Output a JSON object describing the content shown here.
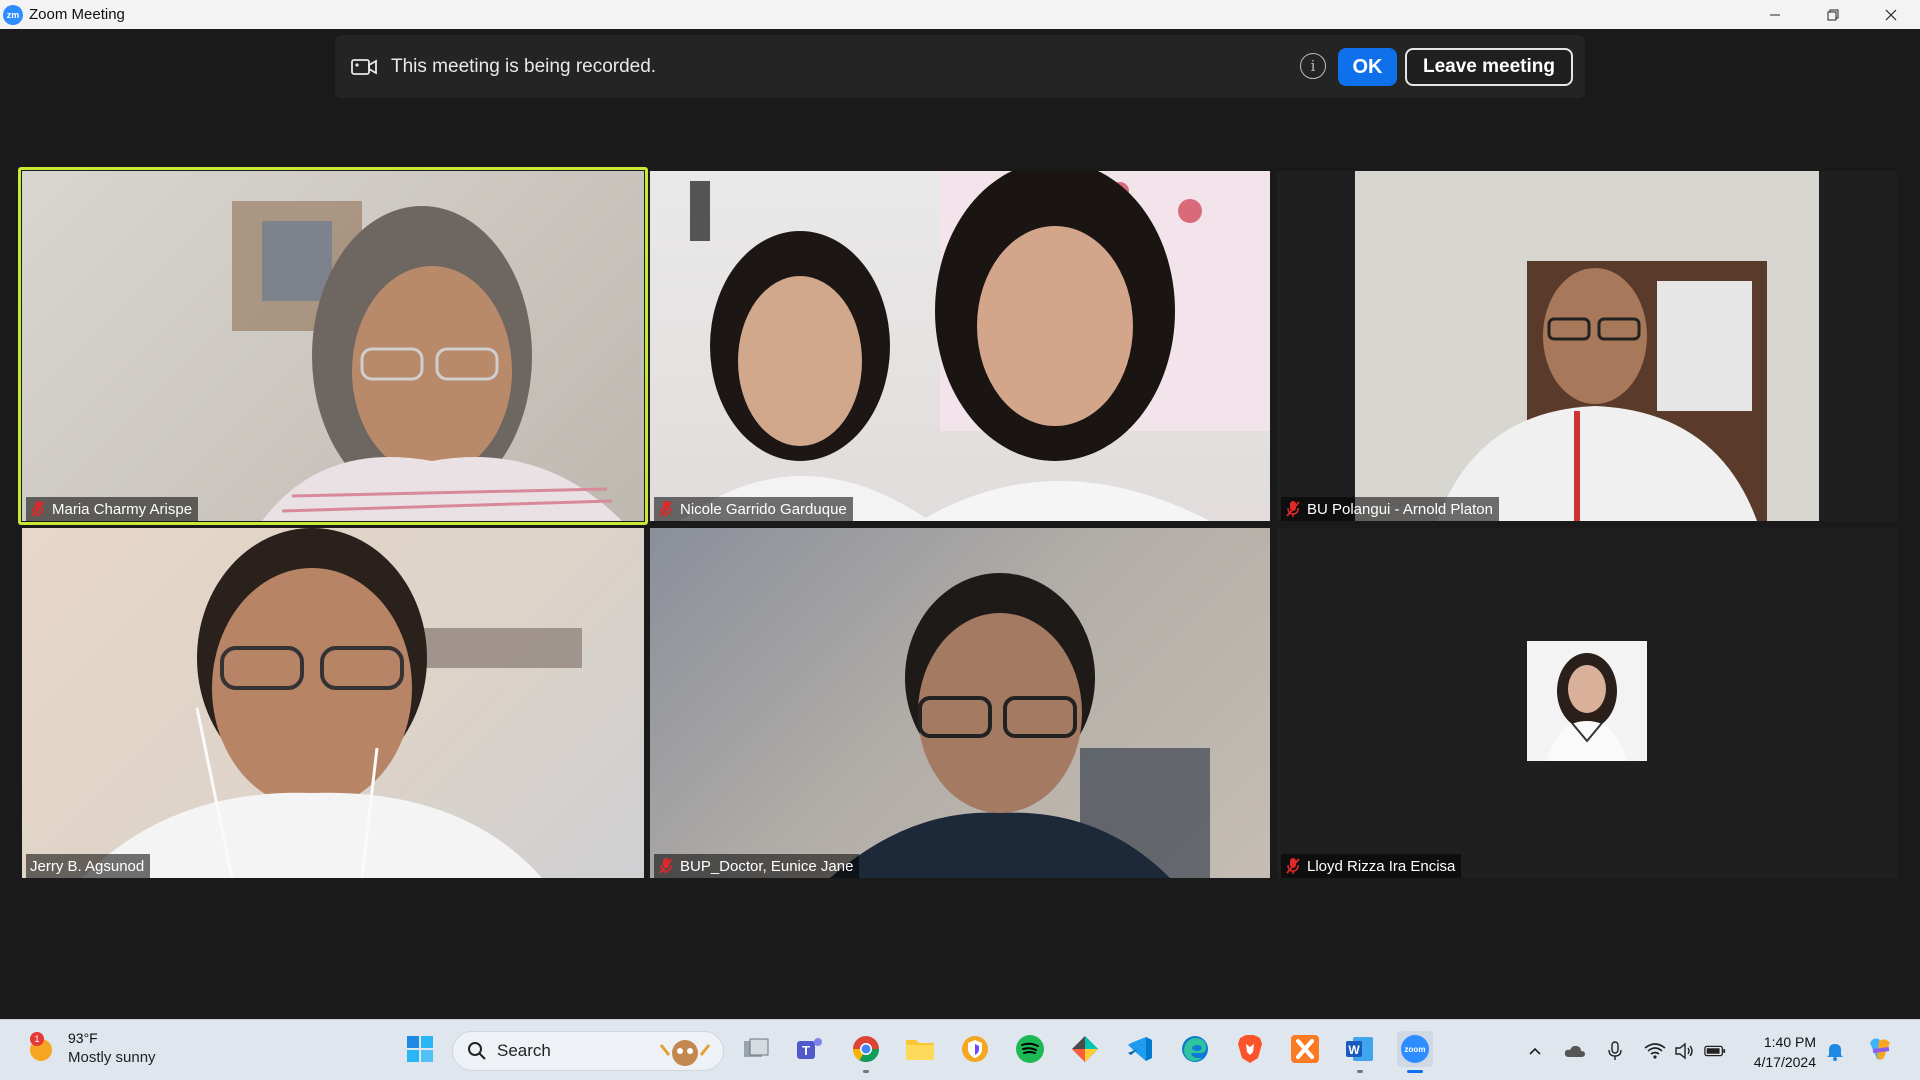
{
  "window": {
    "title": "Zoom Meeting",
    "logo_text": "zm"
  },
  "banner": {
    "message": "This meeting is being recorded.",
    "info_glyph": "i",
    "ok_label": "OK",
    "leave_label": "Leave meeting"
  },
  "participants": [
    {
      "name": "Maria Charmy Arispe",
      "muted": true,
      "active_speaker": true
    },
    {
      "name": "Nicole Garrido Garduque",
      "muted": true
    },
    {
      "name": "BU Polangui - Arnold Platon",
      "muted": true
    },
    {
      "name": "Jerry B. Agsunod",
      "muted": false
    },
    {
      "name": "BUP_Doctor, Eunice Jane",
      "muted": true
    },
    {
      "name": "Lloyd Rizza Ira Encisa",
      "muted": true,
      "video_off": true
    }
  ],
  "taskbar": {
    "weather_temp": "93°F",
    "weather_desc": "Mostly sunny",
    "weather_badge": "1",
    "search_label": "Search",
    "time": "1:40 PM",
    "date": "4/17/2024",
    "pinned": [
      "windows-start",
      "task-view",
      "teams",
      "chrome",
      "file-explorer",
      "proton-vpn",
      "spotify",
      "git-kraken",
      "vscode",
      "edge",
      "brave",
      "xampp",
      "word",
      "zoom"
    ]
  },
  "colors": {
    "active_speaker_border": "#c8ea34",
    "ok_button": "#0e71eb",
    "zoom_blue": "#2d8cff",
    "mute_red": "#e02828"
  }
}
